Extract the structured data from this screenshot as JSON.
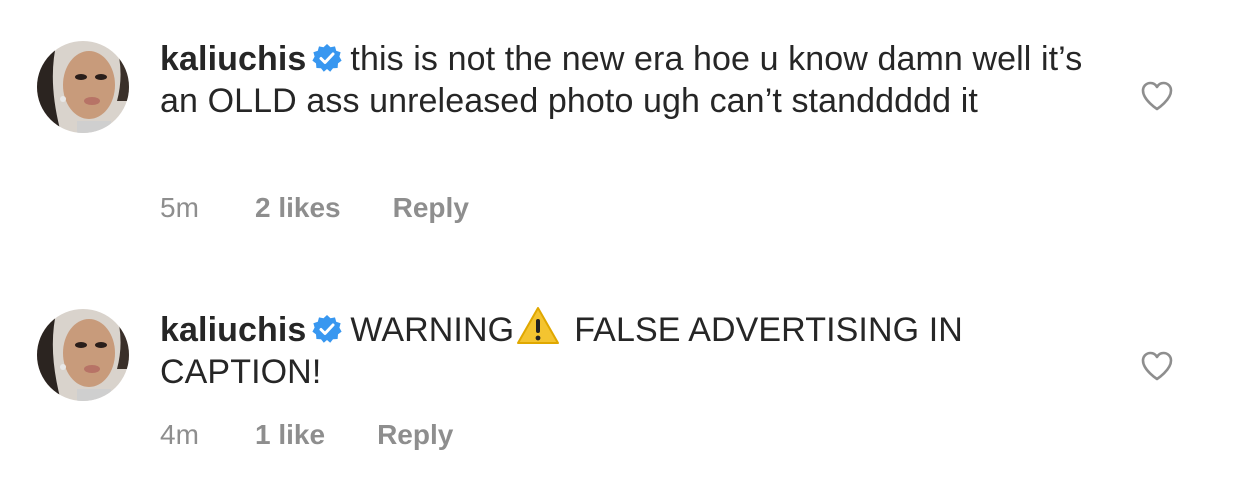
{
  "comments": [
    {
      "username": "kaliuchis",
      "text": "this is not the new era hoe u know damn well it’s an OLLD ass unreleased photo ugh can’t standdddd it",
      "time": "5m",
      "likes": "2 likes",
      "reply": "Reply"
    },
    {
      "username": "kaliuchis",
      "text_before": "WARNING",
      "text_after": "FALSE ADVERTISING IN CAPTION!",
      "time": "4m",
      "likes": "1 like",
      "reply": "Reply"
    }
  ],
  "icons": {
    "verified": "verified-badge-icon",
    "warning": "warning-emoji-icon",
    "like": "heart-outline-icon"
  },
  "colors": {
    "text": "#262626",
    "muted": "#8e8e8e",
    "verified": "#3897f0",
    "warning": "#f4c430"
  }
}
